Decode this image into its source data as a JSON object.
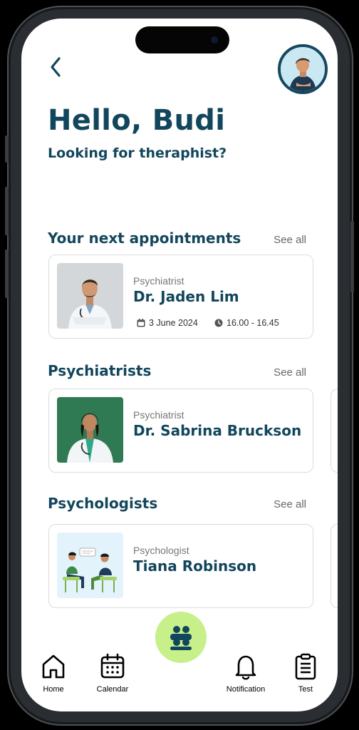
{
  "header": {
    "greeting": "Hello, Budi",
    "subtitle": "Looking for theraphist?"
  },
  "icons": {
    "back": "chevron-left-icon",
    "avatar": "user-avatar",
    "calendar_small": "calendar-icon",
    "clock": "clock-icon",
    "fab": "people-group-icon"
  },
  "appointments": {
    "title": "Your next appointments",
    "see_all": "See all",
    "item": {
      "role": "Psychiatrist",
      "name": "Dr. Jaden Lim",
      "date": "3 June 2024",
      "time": "16.00 - 16.45"
    }
  },
  "psychiatrists": {
    "title": "Psychiatrists",
    "see_all": "See all",
    "item": {
      "role": "Psychiatrist",
      "name": "Dr. Sabrina Bruckson"
    }
  },
  "psychologists": {
    "title": "Psychologists",
    "see_all": "See all",
    "item": {
      "role": "Psychologist",
      "name": "Tiana Robinson"
    }
  },
  "nav": [
    {
      "label": "Home",
      "icon": "home-icon"
    },
    {
      "label": "Calendar",
      "icon": "calendar-icon"
    },
    {
      "label": "Notification",
      "icon": "bell-icon"
    },
    {
      "label": "Test",
      "icon": "clipboard-icon"
    }
  ],
  "colors": {
    "primary": "#12465c",
    "accent": "#c7ef8a",
    "border": "#dcdcdc"
  }
}
